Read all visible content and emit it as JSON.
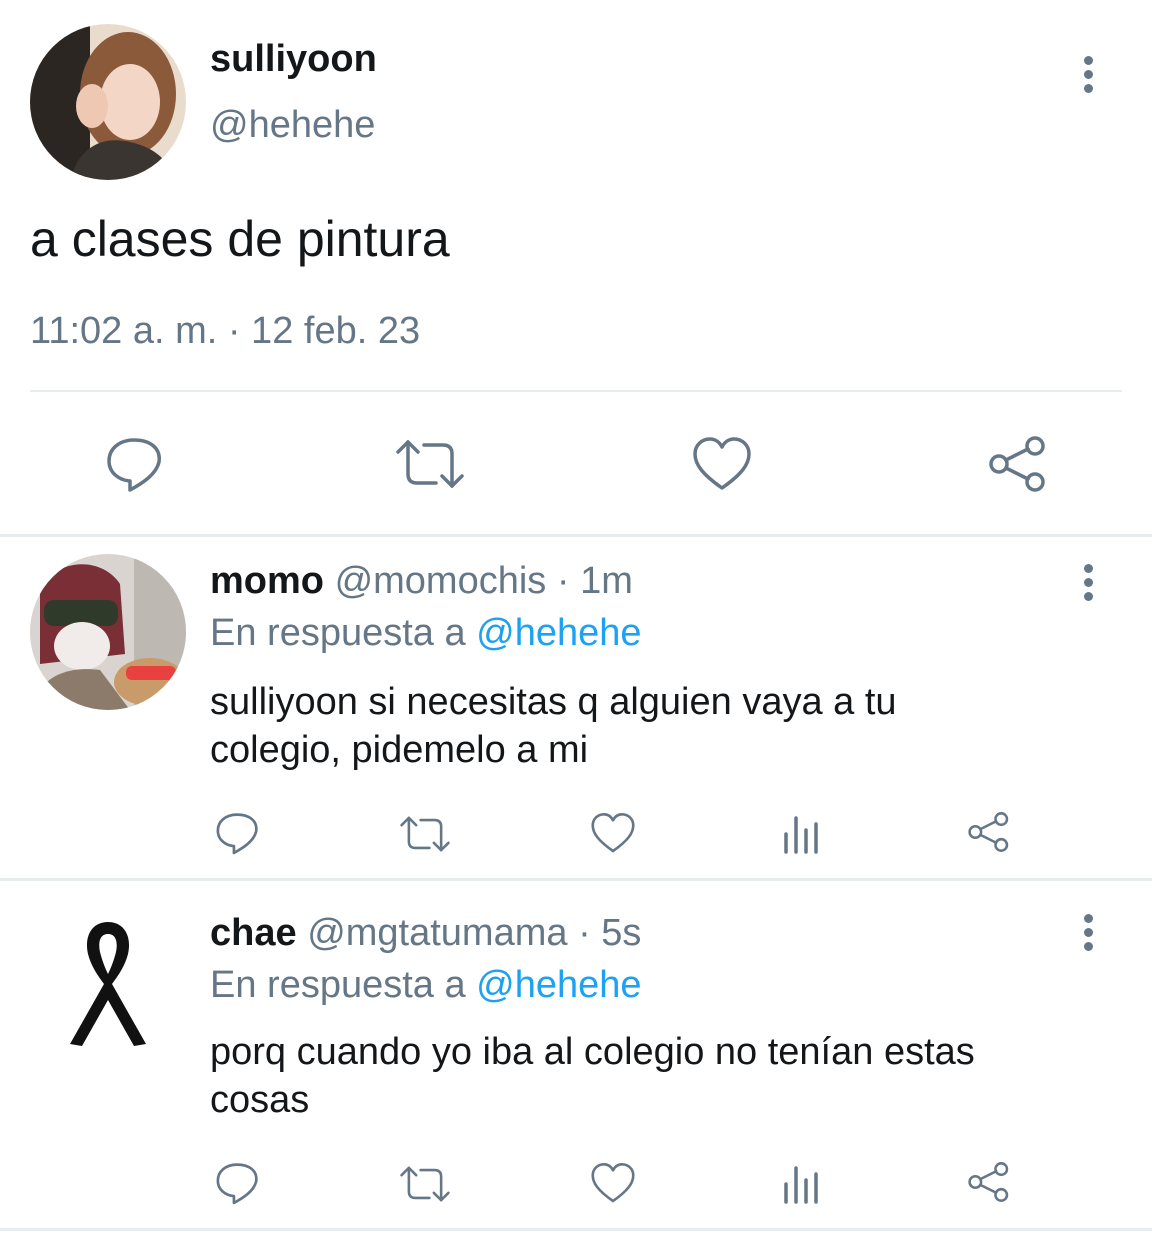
{
  "main_tweet": {
    "display_name": "sulliyoon",
    "handle": "@hehehe",
    "text": "a clases de pintura",
    "timestamp": "11:02 a. m. · 12 feb. 23",
    "actions": [
      "reply-icon",
      "retweet-icon",
      "like-icon",
      "share-icon"
    ]
  },
  "replies": [
    {
      "display_name": "momo",
      "handle": "@momochis",
      "time": "· 1m",
      "reply_prefix": "En respuesta a",
      "reply_to": "@hehehe",
      "text_line1": "sulliyoon si necesitas q alguien vaya a tu",
      "text_line2": "colegio, pidemelo a mi",
      "actions": [
        "reply-icon",
        "retweet-icon",
        "like-icon",
        "analytics-icon",
        "share-icon"
      ]
    },
    {
      "display_name": "chae",
      "handle": "@mgtatumama",
      "time": "· 5s",
      "reply_prefix": "En respuesta a",
      "reply_to": "@hehehe",
      "text_line1": "porq cuando yo iba al colegio no tenían estas",
      "text_line2": "cosas",
      "actions": [
        "reply-icon",
        "retweet-icon",
        "like-icon",
        "analytics-icon",
        "share-icon"
      ]
    }
  ],
  "colors": {
    "text": "#14171a",
    "muted": "#657786",
    "link": "#1da1f2",
    "divider": "#e6ecf0"
  }
}
